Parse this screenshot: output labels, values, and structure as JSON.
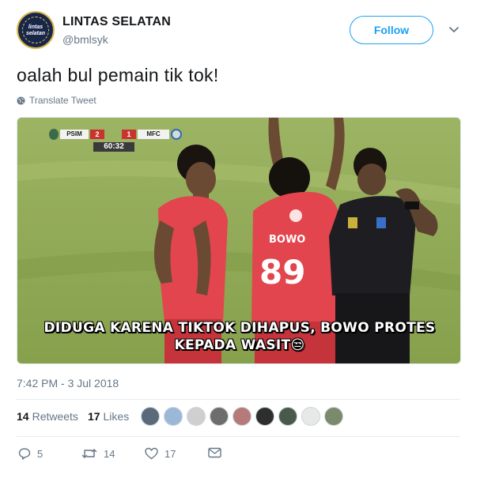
{
  "user": {
    "display_name": "LINTAS SELATAN",
    "handle": "@bmlsyk",
    "avatar_text": "lintas selatan"
  },
  "follow_label": "Follow",
  "tweet": {
    "text": "oalah bul pemain tik tok!",
    "translate_label": "Translate Tweet",
    "timestamp": "7:42 PM - 3 Jul 2018"
  },
  "media": {
    "scoreboard": {
      "home_team": "PSIM",
      "home_score": "2",
      "away_score": "1",
      "away_team": "MFC",
      "clock": "60:32"
    },
    "caption_line1": "DIDUGA KARENA TIKTOK DIHAPUS, BOWO PROTES",
    "caption_line2": "KEPADA WASIT",
    "caption_emoji": "😒",
    "jersey_name": "BOWO",
    "jersey_number": "89"
  },
  "stats": {
    "retweets_count": "14",
    "retweets_label": "Retweets",
    "likes_count": "17",
    "likes_label": "Likes"
  },
  "likers": [
    {
      "color": "#5a6a7a"
    },
    {
      "color": "#9bb8d8"
    },
    {
      "color": "#cfcfcf"
    },
    {
      "color": "#6d6d6d"
    },
    {
      "color": "#b77a7a"
    },
    {
      "color": "#2e2e2e"
    },
    {
      "color": "#4a5a4a"
    },
    {
      "color": "#e8e8e8"
    },
    {
      "color": "#7a8a6a"
    }
  ],
  "actions": {
    "reply_count": "5",
    "retweet_count": "14",
    "like_count": "17"
  },
  "colors": {
    "accent": "#1da1f2",
    "secondary_text": "#657786",
    "jersey_red": "#e2454d",
    "referee_black": "#1e1e22",
    "grass": "#8fa856"
  }
}
